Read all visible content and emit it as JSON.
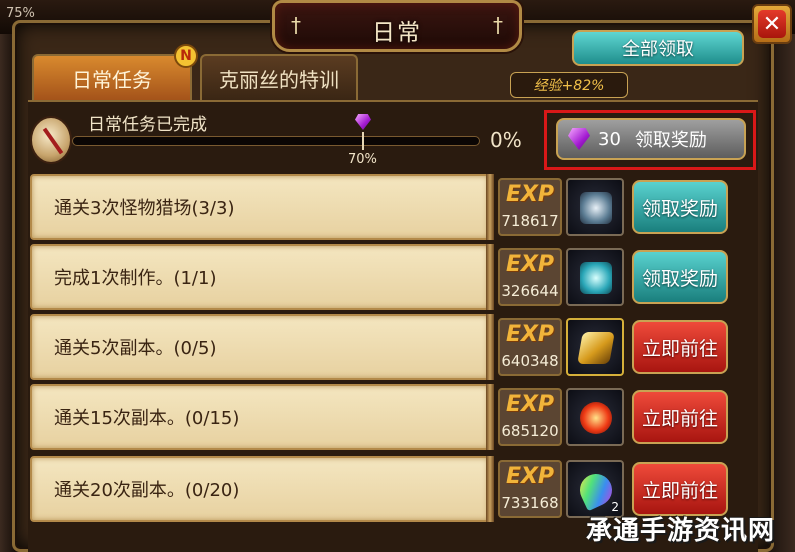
{
  "background": {
    "corner_percent": "75%"
  },
  "window": {
    "title": "日常",
    "close_label": "✕"
  },
  "tabs": [
    {
      "label": "日常任务",
      "badge": "N"
    },
    {
      "label": "克丽丝的特训"
    }
  ],
  "header": {
    "claim_all_label": "全部领取",
    "exp_bonus": "经验+82%"
  },
  "progress": {
    "label": "日常任务已完成",
    "percent_text": "0%",
    "value": 0,
    "milestone_label": "70%",
    "milestone_value": 0.7,
    "reward_count": "30",
    "reward_button_label": "领取奖励"
  },
  "tasks": [
    {
      "text": "通关3次怪物猎场(3/3)",
      "exp_label": "EXP",
      "exp_value": "718617",
      "item_icon": "ore-icon",
      "button": "领取奖励",
      "status": "claim"
    },
    {
      "text": "完成1次制作。(1/1)",
      "exp_label": "EXP",
      "exp_value": "326644",
      "item_icon": "crystal-ore-icon",
      "button": "领取奖励",
      "status": "claim"
    },
    {
      "text": "通关5次副本。(0/5)",
      "exp_label": "EXP",
      "exp_value": "640348",
      "item_icon": "gold-bar-icon",
      "button": "立即前往",
      "status": "go"
    },
    {
      "text": "通关15次副本。(0/15)",
      "exp_label": "EXP",
      "exp_value": "685120",
      "item_icon": "fire-orb-icon",
      "button": "立即前往",
      "status": "go"
    },
    {
      "text": "通关20次副本。(0/20)",
      "exp_label": "EXP",
      "exp_value": "733168",
      "item_icon": "rainbow-feather-icon",
      "item_qty": "2",
      "button": "立即前往",
      "status": "go"
    }
  ],
  "watermark": "承通手游资讯网",
  "colors": {
    "claim_button": "#1f8e8c",
    "go_button": "#a81510",
    "highlight_frame": "#d91818",
    "exp_text": "#f1b43a"
  }
}
